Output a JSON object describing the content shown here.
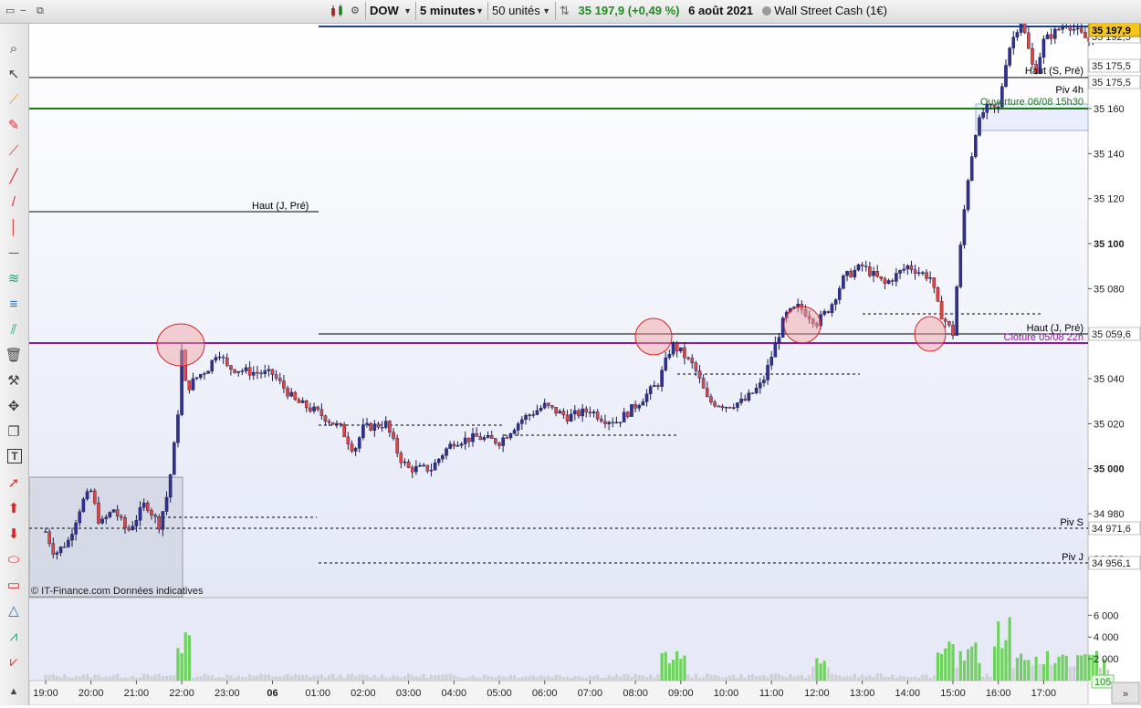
{
  "toolbar": {
    "symbol": "DOW",
    "timeframe": "5 minutes",
    "units": "50 unités",
    "price_change": "35 197,9 (+0,49 %)",
    "date": "6 août 2021",
    "instrument": "Wall Street Cash (1€)"
  },
  "left_tools": [
    "zoom-icon",
    "cursor-icon",
    "ruler-icon",
    "ruler-alt-icon",
    "segment-icon",
    "line-icon",
    "vertical-line-icon",
    "horizontal-line-icon",
    "fibonacci-icon",
    "fibonacci-alt-icon",
    "channel-icon",
    "trash-icon",
    "tools-icon",
    "move-icon",
    "copy-icon",
    "text-icon",
    "arrow-icon",
    "up-arrow-icon",
    "down-arrow-icon",
    "ellipse-icon",
    "rectangle-icon",
    "triangle-icon",
    "pattern-icon",
    "pattern-alt-icon",
    "collapse-icon"
  ],
  "colors": {
    "up": "#2e3192",
    "down": "#e0463f",
    "pivot": "#8b1d9a",
    "open_line": "#1a7a1a",
    "top_line": "#1f3fa0",
    "volume": "#cfcfd6",
    "volume_high": "#6fd15e"
  },
  "chart_data": {
    "type": "candlestick",
    "watermark": "© IT-Finance.com  Données indicatives",
    "x_ticks": [
      "19:00",
      "20:00",
      "21:00",
      "22:00",
      "23:00",
      "06",
      "01:00",
      "02:00",
      "03:00",
      "04:00",
      "05:00",
      "06:00",
      "07:00",
      "08:00",
      "09:00",
      "10:00",
      "11:00",
      "12:00",
      "13:00",
      "14:00",
      "15:00",
      "16:00",
      "17:00"
    ],
    "y_ticks": [
      "35 160",
      "35 140",
      "35 120",
      "35 100",
      "35 080",
      "35 040",
      "35 020",
      "35 000",
      "34 980",
      "34 960"
    ],
    "ylim": [
      34950,
      35210
    ],
    "current_price": "35 197,9",
    "price_levels": [
      {
        "value": 35192.5,
        "label": "35 192,5"
      },
      {
        "value": 35175.5,
        "label": "35 175,5"
      },
      {
        "value": 35175.5,
        "label": "35 175,5"
      },
      {
        "value": 35059.6,
        "label": "35 059,6"
      },
      {
        "value": 34971.6,
        "label": "34 971,6"
      },
      {
        "value": 34956.1,
        "label": "34 956,1"
      }
    ],
    "annotations": [
      "Haut (J, Pré)",
      "Haut (J, Pré)",
      "Haut (S, Pré)",
      "Piv 4h",
      "Ouverture 06/08 15h30",
      "Clôture 05/08 22h",
      "Piv S",
      "Piv J"
    ],
    "close_path": [
      [
        19.0,
        34972
      ],
      [
        19.2,
        34962
      ],
      [
        19.5,
        34968
      ],
      [
        19.8,
        34985
      ],
      [
        20.0,
        34990
      ],
      [
        20.2,
        34975
      ],
      [
        20.5,
        34982
      ],
      [
        20.8,
        34972
      ],
      [
        21.0,
        34978
      ],
      [
        21.2,
        34985
      ],
      [
        21.5,
        34975
      ],
      [
        21.7,
        34990
      ],
      [
        21.9,
        35020
      ],
      [
        22.0,
        35052
      ],
      [
        22.1,
        35035
      ],
      [
        22.3,
        35040
      ],
      [
        22.6,
        35045
      ],
      [
        22.8,
        35053
      ],
      [
        23.0,
        35045
      ],
      [
        23.5,
        35043
      ],
      [
        24.0,
        35042
      ],
      [
        24.5,
        35030
      ],
      [
        25.0,
        35025
      ],
      [
        25.5,
        35018
      ],
      [
        25.8,
        35008
      ],
      [
        26.0,
        35018
      ],
      [
        26.5,
        35020
      ],
      [
        26.8,
        35005
      ],
      [
        27.0,
        35000
      ],
      [
        27.5,
        35000
      ],
      [
        27.8,
        35008
      ],
      [
        28.0,
        35012
      ],
      [
        28.5,
        35014
      ],
      [
        29.0,
        35012
      ],
      [
        29.5,
        35022
      ],
      [
        30.0,
        35028
      ],
      [
        30.5,
        35023
      ],
      [
        31.0,
        35026
      ],
      [
        31.3,
        35022
      ],
      [
        31.6,
        35021
      ],
      [
        32.0,
        35028
      ],
      [
        32.5,
        35038
      ],
      [
        32.8,
        35055
      ],
      [
        33.0,
        35052
      ],
      [
        33.3,
        35045
      ],
      [
        33.6,
        35030
      ],
      [
        34.0,
        35028
      ],
      [
        34.4,
        35030
      ],
      [
        34.8,
        35038
      ],
      [
        35.0,
        35050
      ],
      [
        35.3,
        35068
      ],
      [
        35.6,
        35072
      ],
      [
        36.0,
        35065
      ],
      [
        36.3,
        35072
      ],
      [
        36.6,
        35085
      ],
      [
        37.0,
        35090
      ],
      [
        37.5,
        35082
      ],
      [
        38.0,
        35090
      ],
      [
        38.5,
        35085
      ],
      [
        38.7,
        35070
      ],
      [
        39.0,
        35060
      ],
      [
        39.1,
        35085
      ],
      [
        39.3,
        35125
      ],
      [
        39.5,
        35150
      ],
      [
        39.7,
        35160
      ],
      [
        40.0,
        35160
      ],
      [
        40.2,
        35185
      ],
      [
        40.5,
        35200
      ],
      [
        40.8,
        35175
      ],
      [
        41.0,
        35190
      ],
      [
        41.5,
        35198
      ],
      [
        42.0,
        35190
      ],
      [
        42.4,
        35197.9
      ]
    ],
    "volume": {
      "y_ticks": [
        "6 000",
        "4 000",
        "2 000"
      ],
      "ylim": [
        0,
        7200
      ],
      "current": "105"
    }
  }
}
